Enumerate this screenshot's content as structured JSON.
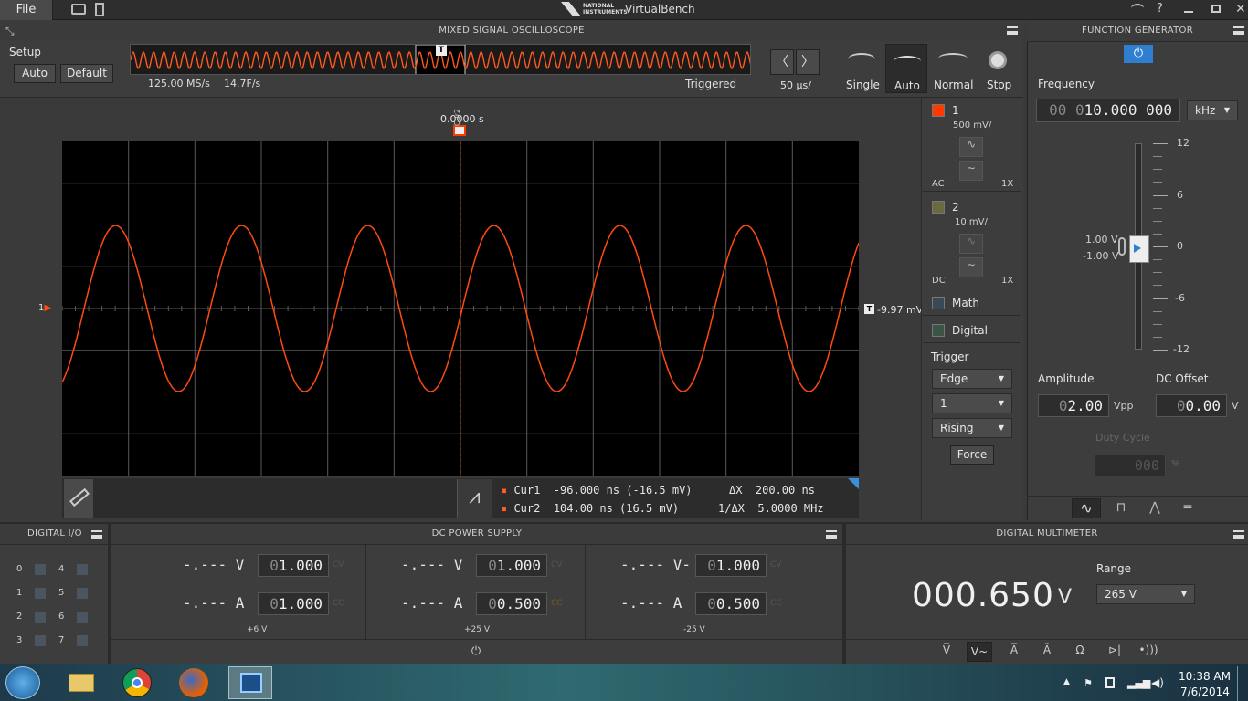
{
  "topbar": {
    "file": "File",
    "brand": "NATIONAL INSTRUMENTS",
    "app": "VirtualBench"
  },
  "scope": {
    "title": "MIXED SIGNAL OSCILLOSCOPE",
    "setup": "Setup",
    "auto": "Auto",
    "default": "Default",
    "sample_rate": "125.00 MS/s",
    "frame_rate": "14.7F/s",
    "status": "Triggered",
    "timebase": "50 µs/",
    "modes": [
      "Single",
      "Auto",
      "Normal",
      "Stop"
    ],
    "time_readout": "0.0000 s",
    "trigger_level": "-9.97 mV",
    "ch_marker": "1",
    "trigger_marker": "T",
    "cursor_marker": "Cur2",
    "cur1_label": "Cur1",
    "cur1_value": "-96.000 ns (-16.5 mV)",
    "cur2_label": "Cur2",
    "cur2_value": "104.00 ns (16.5 mV)",
    "dx_label": "ΔX",
    "dx_value": "200.00 ns",
    "inv_dx_label": "1/ΔX",
    "inv_dx_value": "5.0000 MHz",
    "accent": "#ff5a1f"
  },
  "channels": [
    {
      "num": "1",
      "scale": "500 mV/",
      "coupling": "AC",
      "probe": "1X",
      "color": "#ff3a00"
    },
    {
      "num": "2",
      "scale": "10 mV/",
      "coupling": "DC",
      "probe": "1X",
      "color": "#6b6a3e"
    }
  ],
  "math": "Math",
  "digital": "Digital",
  "trigger": {
    "title": "Trigger",
    "type": "Edge",
    "source": "1",
    "slope": "Rising",
    "force": "Force"
  },
  "fgen": {
    "title": "FUNCTION GENERATOR",
    "frequency_label": "Frequency",
    "freq_prefix": "00 0",
    "freq_value": "10.000 000",
    "freq_unit": "kHz",
    "slider_ticks": [
      "12",
      "6",
      "0",
      "-6",
      "-12"
    ],
    "high": "1.00 V",
    "low": "-1.00 V",
    "amplitude_label": "Amplitude",
    "amp_prefix": "0",
    "amp_value": "2.00",
    "amp_unit": "Vpp",
    "offset_label": "DC Offset",
    "off_prefix": "0",
    "off_value": "0.00",
    "off_unit": "V",
    "duty_label": "Duty Cycle",
    "duty_value": "000",
    "duty_unit": "%"
  },
  "dio": {
    "title": "DIGITAL I/O",
    "left": [
      "0",
      "1",
      "2",
      "3"
    ],
    "right": [
      "4",
      "5",
      "6",
      "7"
    ]
  },
  "psu": {
    "title": "DC POWER SUPPLY",
    "channels": [
      {
        "vread": "-.--- V",
        "vset_prefix": "0",
        "vset": "1.000",
        "aread": "-.--- A",
        "aset_prefix": "0",
        "aset": "1.000",
        "name": "+6 V"
      },
      {
        "vread": "-.--- V",
        "vset_prefix": "0",
        "vset": "1.000",
        "aread": "-.--- A",
        "aset_prefix": "0",
        "aset": "0.500",
        "name": "+25 V"
      },
      {
        "vread": "-.--- V-",
        "vset_prefix": "0",
        "vset": "1.000",
        "aread": "-.--- A",
        "aset_prefix": "0",
        "aset": "0.500",
        "name": "-25 V"
      }
    ],
    "cv": "CV",
    "cc": "CC"
  },
  "dmm": {
    "title": "DIGITAL MULTIMETER",
    "reading": "000.650",
    "unit": "V",
    "range_label": "Range",
    "range": "265 V"
  },
  "taskbar": {
    "time": "10:38 AM",
    "date": "7/6/2014"
  }
}
